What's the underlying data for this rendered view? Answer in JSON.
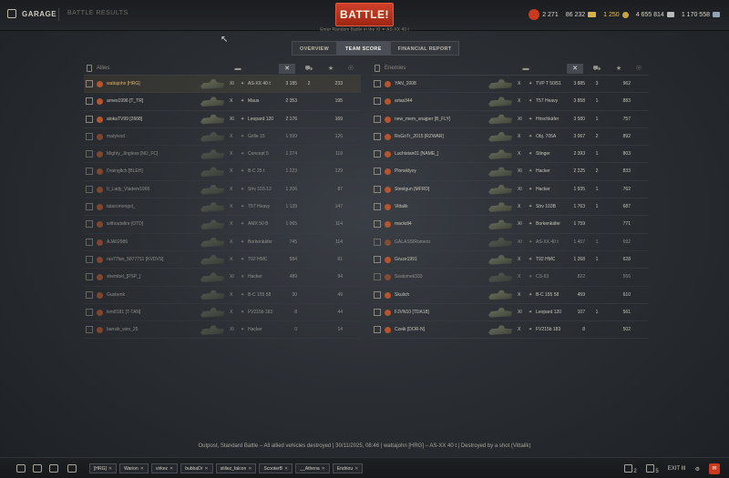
{
  "header": {
    "garage_label": "GARAGE",
    "battle_results_label": "BATTLE RESULTS",
    "battle_button": "BATTLE!",
    "battle_subtitle": "Enter Random Battle in the XI ✦ AS-XX 40 t",
    "currencies": {
      "premium": "2 271",
      "gold": "86 232",
      "bonds": "1 250",
      "credits": "4 655 814",
      "free_xp": "1 170 558"
    }
  },
  "tabs": [
    {
      "label": "OVERVIEW"
    },
    {
      "label": "TEAM SCORE"
    },
    {
      "label": "FINANCIAL REPORT"
    }
  ],
  "allies": {
    "title": "Allies",
    "rows": [
      {
        "name": "wattajohn [HRG]",
        "tier": "XI",
        "type": "✦",
        "tank": "AS-XX 40 t",
        "damage": "3 185",
        "kills": "2",
        "xp": "233",
        "self": true,
        "dead": false
      },
      {
        "name": "arnes1996 [T_TR]",
        "tier": "X",
        "type": "✦",
        "tank": "Maus",
        "damage": "2 353",
        "kills": "",
        "xp": "195",
        "self": false,
        "dead": false
      },
      {
        "name": "alokaTV99 [2668]",
        "tier": "XI",
        "type": "✦",
        "tank": "Leopard 120",
        "damage": "2 176",
        "kills": "",
        "xp": "169",
        "self": false,
        "dead": false
      },
      {
        "name": "matyivod",
        "tier": "X",
        "type": "✦",
        "tank": "Grille 15",
        "damage": "1 599",
        "kills": "",
        "xp": "126",
        "self": false,
        "dead": true
      },
      {
        "name": "Mighty_Jingless [NU_FC]",
        "tier": "X",
        "type": "✦",
        "tank": "Concept 5",
        "damage": "1 274",
        "kills": "",
        "xp": "119",
        "self": false,
        "dead": true
      },
      {
        "name": "Draingltch [BLEH]",
        "tier": "X",
        "type": "✦",
        "tank": "B-C 25 t",
        "damage": "1 223",
        "kills": "",
        "xp": "129",
        "self": false,
        "dead": true
      },
      {
        "name": "II_Lady_Vladem1965",
        "tier": "X",
        "type": "✦",
        "tank": "Strv 103-12",
        "damage": "1 206",
        "kills": "",
        "xp": "87",
        "self": false,
        "dead": true
      },
      {
        "name": "tatarcmongol_",
        "tier": "X",
        "type": "✦",
        "tank": "T57 Heavy",
        "damage": "1 139",
        "kills": "",
        "xp": "147",
        "self": false,
        "dead": true
      },
      {
        "name": "withoutafire [OTD]",
        "tier": "X",
        "type": "✦",
        "tank": "AMX 50 B",
        "damage": "1 065",
        "kills": "",
        "xp": "114",
        "self": false,
        "dead": true
      },
      {
        "name": "AJA02986",
        "tier": "X",
        "type": "✦",
        "tank": "Borkenkäfer",
        "damage": "745",
        "kills": "",
        "xp": "114",
        "self": false,
        "dead": true
      },
      {
        "name": "ras77fan_5877711 [KVDVS]",
        "tier": "X",
        "type": "✦",
        "tank": "T92 HMC",
        "damage": "584",
        "kills": "",
        "xp": "61",
        "self": false,
        "dead": true
      },
      {
        "name": "shembel_[PSP_]",
        "tier": "XI",
        "type": "✦",
        "tank": "Hacker",
        "damage": "489",
        "kills": "",
        "xp": "94",
        "self": false,
        "dead": true
      },
      {
        "name": "Gusbenk",
        "tier": "X",
        "type": "✦",
        "tank": "B-C 155 58",
        "damage": "30",
        "kills": "",
        "xp": "49",
        "self": false,
        "dead": true
      },
      {
        "name": "lem8181 [T-TAN]",
        "tier": "X",
        "type": "✦",
        "tank": "FV215b 183",
        "damage": "8",
        "kills": "",
        "xp": "44",
        "self": false,
        "dead": true
      },
      {
        "name": "bansik_wim_25",
        "tier": "XI",
        "type": "✦",
        "tank": "Hacker",
        "damage": "0",
        "kills": "",
        "xp": "14",
        "self": false,
        "dead": true
      }
    ]
  },
  "enemies": {
    "title": "Enemies",
    "rows": [
      {
        "name": "YAN_2008",
        "tier": "X",
        "type": "✦",
        "tank": "TVP T 50/51",
        "damage": "3 885",
        "kills": "3",
        "xp": "962",
        "dead": false
      },
      {
        "name": "artas344",
        "tier": "X",
        "type": "✦",
        "tank": "T57 Heavy",
        "damage": "3 858",
        "kills": "1",
        "xp": "883",
        "dead": false
      },
      {
        "name": "new_mem_snajper [B_FLY]",
        "tier": "XI",
        "type": "✦",
        "tank": "Hirschkäfer",
        "damage": "3 580",
        "kills": "1",
        "xp": "757",
        "dead": false
      },
      {
        "name": "RoGoTr_2015 [RZWAR]",
        "tier": "X",
        "type": "✦",
        "tank": "Obj. 705A",
        "damage": "3 067",
        "kills": "2",
        "xp": "892",
        "dead": false
      },
      {
        "name": "Luchistan01 [NAME_]",
        "tier": "X",
        "type": "✦",
        "tank": "Stinger",
        "damage": "2 393",
        "kills": "1",
        "xp": "803",
        "dead": false
      },
      {
        "name": "Plonxklyoy",
        "tier": "XI",
        "type": "✦",
        "tank": "Hacker",
        "damage": "2 225",
        "kills": "2",
        "xp": "833",
        "dead": false
      },
      {
        "name": "Steelgun [MFRD]",
        "tier": "XI",
        "type": "✦",
        "tank": "Hacker",
        "damage": "1 935",
        "kills": "1",
        "xp": "762",
        "dead": false
      },
      {
        "name": "Vittalik",
        "tier": "X",
        "type": "✦",
        "tank": "Strv 103B",
        "damage": "1 763",
        "kills": "1",
        "xp": "687",
        "dead": false
      },
      {
        "name": "mackdi4",
        "tier": "XI",
        "type": "✦",
        "tank": "Borkenkäfer",
        "damage": "1 759",
        "kills": "",
        "xp": "771",
        "dead": false
      },
      {
        "name": "GALASSIRomero",
        "tier": "XI",
        "type": "✦",
        "tank": "AS-XX 40 t",
        "damage": "1 457",
        "kills": "1",
        "xp": "692",
        "dead": true
      },
      {
        "name": "Gruze1991",
        "tier": "X",
        "type": "✦",
        "tank": "T92 HMC",
        "damage": "1 268",
        "kills": "1",
        "xp": "628",
        "dead": false
      },
      {
        "name": "Ssutomek333",
        "tier": "X",
        "type": "✦",
        "tank": "CS-63",
        "damage": "822",
        "kills": "",
        "xp": "556",
        "dead": true
      },
      {
        "name": "Skulich",
        "tier": "X",
        "type": "✦",
        "tank": "B-C 155 58",
        "damage": "459",
        "kills": "",
        "xp": "610",
        "dead": false
      },
      {
        "name": "FJVN10 [TDA18]",
        "tier": "XI",
        "type": "✦",
        "tank": "Leopard 120",
        "damage": "107",
        "kills": "1",
        "xp": "561",
        "dead": false
      },
      {
        "name": "Czeik [DOR-N]",
        "tier": "X",
        "type": "✦",
        "tank": "FV215b 183",
        "damage": "8",
        "kills": "",
        "xp": "502",
        "dead": false
      }
    ]
  },
  "footer": {
    "info": "Outpost, Standard Battle – All allied vehicles destroyed  |  30/11/2025, 08:46  |  wattajohn [HRG] – AS-XX 40 t  |  Destroyed by a shot (Vittalik)",
    "squad": [
      "[HRG]",
      "Warion",
      "virkez",
      "bubbaDr",
      "stiliez_falcon",
      "ScooterB",
      "__Athena",
      "Endriou"
    ],
    "right": {
      "a": "2",
      "b": "5",
      "c": "EXIT III"
    }
  }
}
